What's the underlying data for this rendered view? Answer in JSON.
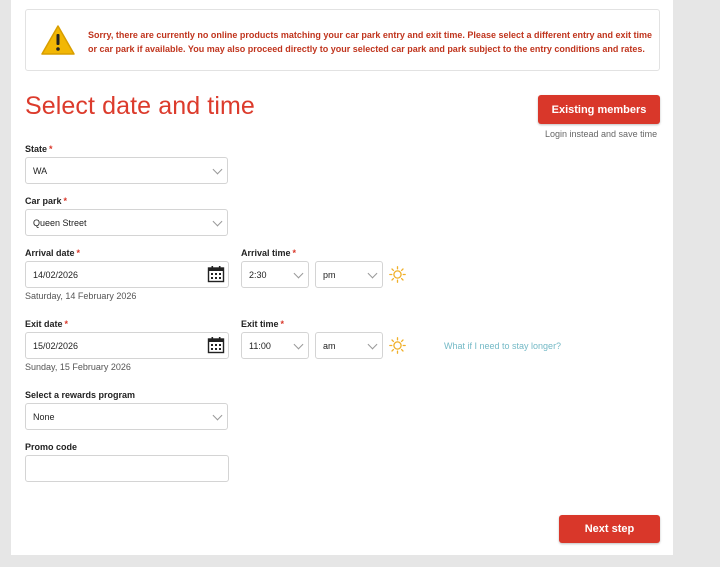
{
  "alert": {
    "message": "Sorry, there are currently no online products matching your car park entry and exit time. Please select a different entry and exit time or car park if available. You may also proceed directly to your selected car park and park subject to the entry conditions and rates."
  },
  "header": {
    "title": "Select date and time",
    "members_button": "Existing members",
    "members_subtext": "Login instead and save time"
  },
  "form": {
    "state": {
      "label": "State",
      "required": "*",
      "value": "WA"
    },
    "car_park": {
      "label": "Car park",
      "required": "*",
      "value": "Queen Street"
    },
    "arrival_date": {
      "label": "Arrival date",
      "required": "*",
      "value": "14/02/2026",
      "long": "Saturday, 14 February 2026"
    },
    "arrival_time": {
      "label": "Arrival time",
      "required": "*",
      "time": "2:30",
      "period": "pm"
    },
    "exit_date": {
      "label": "Exit date",
      "required": "*",
      "value": "15/02/2026",
      "long": "Sunday, 15 February 2026"
    },
    "exit_time": {
      "label": "Exit time",
      "required": "*",
      "time": "11:00",
      "period": "am"
    },
    "stay_longer_link": "What if I need to stay longer?",
    "rewards": {
      "label": "Select a rewards program",
      "value": "None"
    },
    "promo": {
      "label": "Promo code",
      "value": ""
    }
  },
  "footer": {
    "next_button": "Next step"
  },
  "colors": {
    "accent": "#d9372a",
    "alert_text": "#c0351e",
    "link": "#73b9c6",
    "sun": "#f0b02a"
  },
  "icons": {
    "alert": "warning-icon",
    "calendar": "calendar-icon",
    "sun": "sun-icon",
    "chevron": "chevron-down-icon"
  }
}
